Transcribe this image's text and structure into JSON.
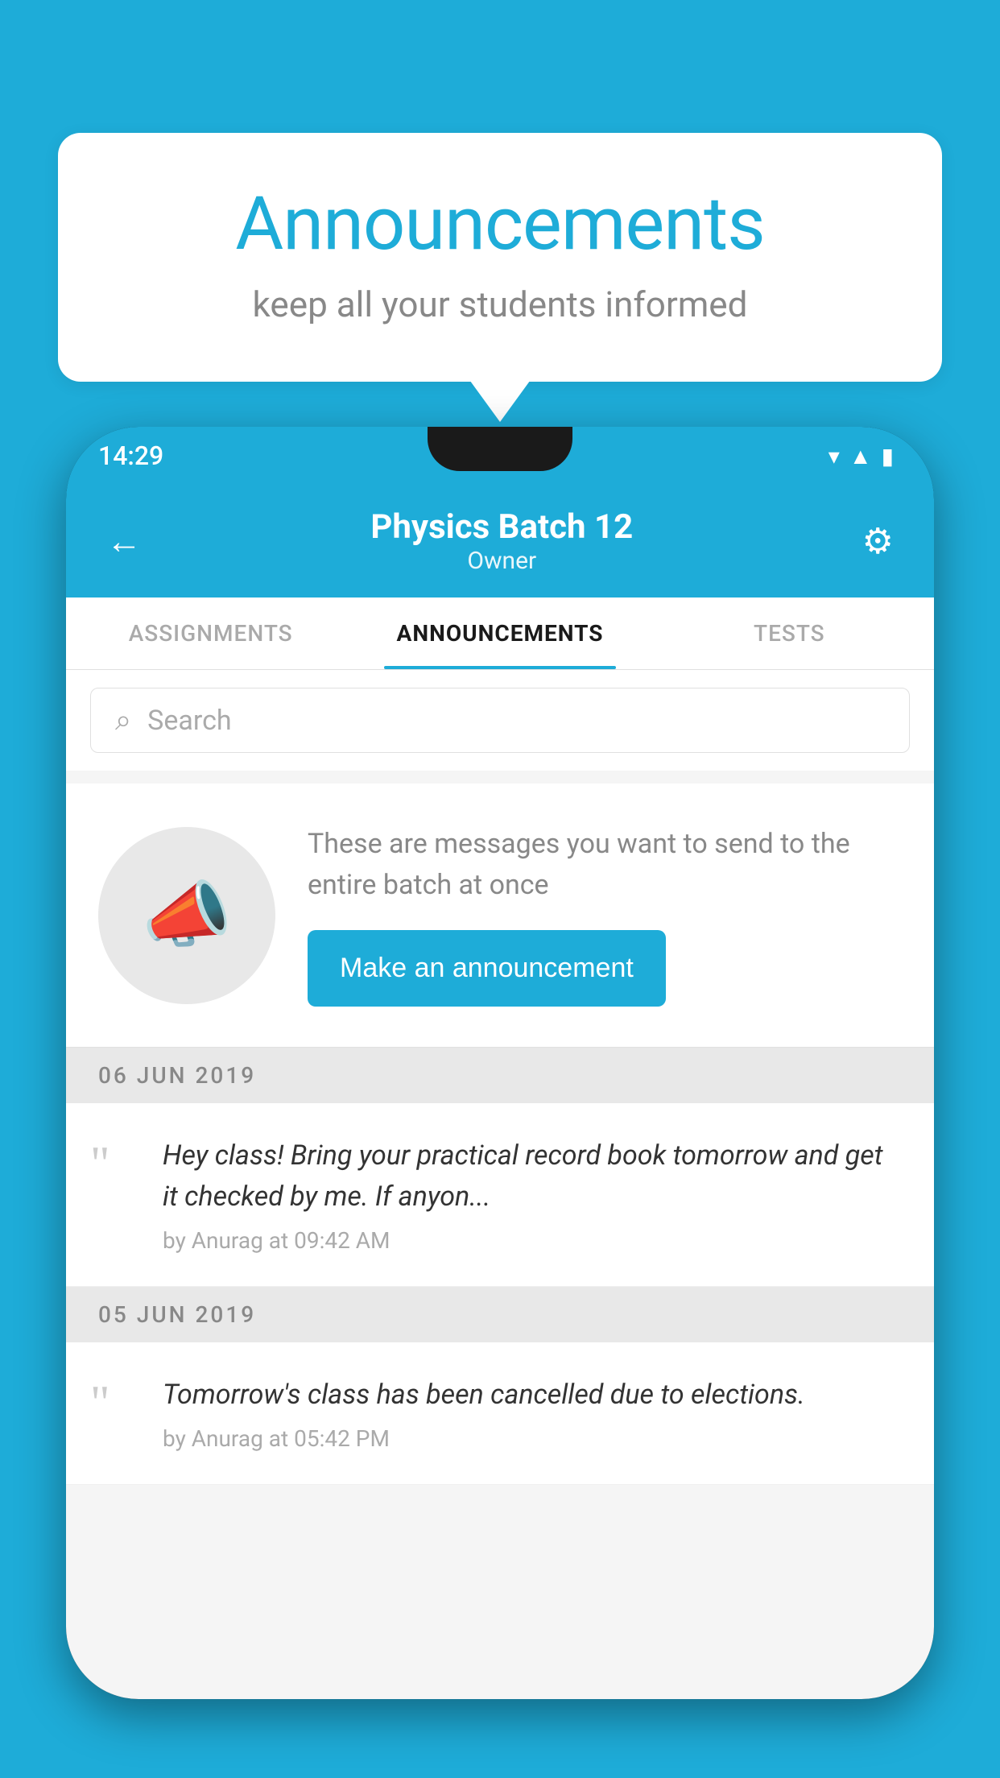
{
  "background_color": "#1EACD8",
  "speech_bubble": {
    "title": "Announcements",
    "subtitle": "keep all your students informed"
  },
  "phone": {
    "status_bar": {
      "time": "14:29"
    },
    "header": {
      "title": "Physics Batch 12",
      "subtitle": "Owner",
      "back_label": "←",
      "settings_label": "⚙"
    },
    "tabs": [
      {
        "label": "ASSIGNMENTS",
        "active": false
      },
      {
        "label": "ANNOUNCEMENTS",
        "active": true
      },
      {
        "label": "TESTS",
        "active": false
      }
    ],
    "search": {
      "placeholder": "Search"
    },
    "announcement_intro": {
      "description": "These are messages you want to send to the entire batch at once",
      "button_label": "Make an announcement"
    },
    "date_groups": [
      {
        "date": "06  JUN  2019",
        "announcements": [
          {
            "text": "Hey class! Bring your practical record book tomorrow and get it checked by me. If anyon...",
            "meta": "by Anurag at 09:42 AM"
          }
        ]
      },
      {
        "date": "05  JUN  2019",
        "announcements": [
          {
            "text": "Tomorrow's class has been cancelled due to elections.",
            "meta": "by Anurag at 05:42 PM"
          }
        ]
      }
    ]
  }
}
